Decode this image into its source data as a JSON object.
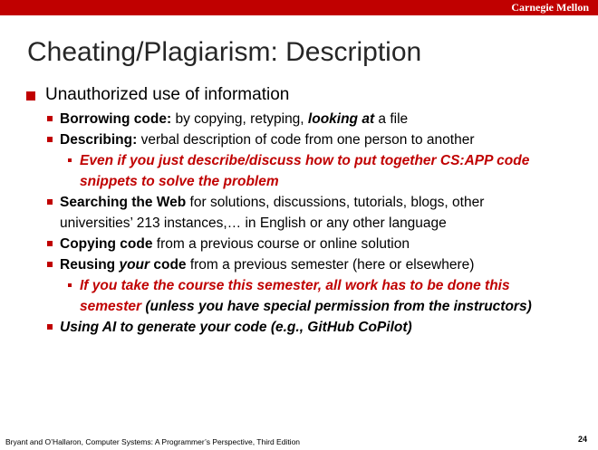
{
  "header": {
    "brand": "Carnegie Mellon",
    "bar_color": "#c00000"
  },
  "slide": {
    "title": "Cheating/Plagiarism: Description",
    "bullet1": "Unauthorized use of information",
    "b2_borrow": {
      "bold": "Borrowing code:",
      "text": " by copying, retyping, ",
      "bi": "looking at",
      "end": " a file"
    },
    "b2_describe": {
      "bold": "Describing:",
      "text": " verbal description of code from one person to another"
    },
    "b3_describe": {
      "line1": "Even if you just describe/discuss how to put together CS:APP code",
      "line2": "snippets to solve the problem"
    },
    "b2_search": {
      "bold": "Searching the Web",
      "text": " for solutions, discussions, tutorials, blogs, other",
      "line2": "universities’ 213 instances,…  in English or any other language"
    },
    "b2_copy": {
      "bold": "Copying code",
      "text": " from a previous course or online solution"
    },
    "b2_reuse": {
      "bold1": "Reusing ",
      "bi": "your",
      "bold2": " code",
      "text": " from a previous semester (here or elsewhere)"
    },
    "b3_reuse": {
      "line1": "If you take the course this semester, all work has to be done this",
      "line2_red": "semester",
      "line2_bi": " (unless you have special permission from the instructors)"
    },
    "b2_ai": "Using AI to generate your code (e.g., GitHub CoPilot)"
  },
  "footer": {
    "text": "Bryant and O’Hallaron, Computer Systems: A Programmer’s Perspective, Third Edition",
    "page": "24"
  }
}
